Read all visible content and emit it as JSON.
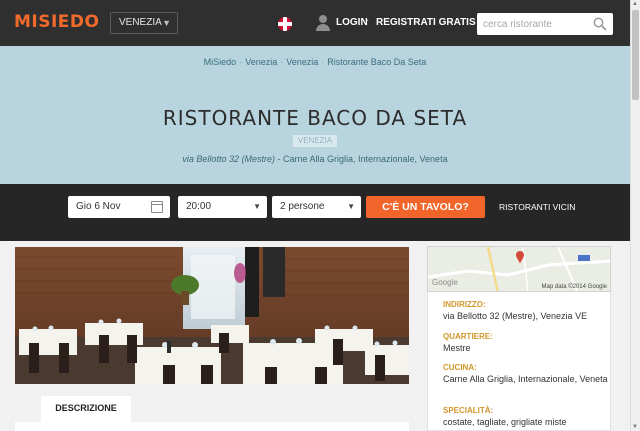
{
  "header": {
    "logo": "MISIEDO",
    "city_selector": "VENEZIA",
    "language_icon": "uk-flag-icon",
    "login": "LOGIN",
    "separator": "·",
    "register": "REGISTRATI GRATIS",
    "search_placeholder": "cerca ristorante"
  },
  "hero": {
    "breadcrumb": [
      "MiSiedo",
      "Venezia",
      "Venezia",
      "Ristorante Baco Da Seta"
    ],
    "breadcrumb_sep": "·",
    "title": "RISTORANTE BACO DA SETA",
    "city_badge": "VENEZIA",
    "address": "via Bellotto 32 (Mestre)",
    "cuisine_line": " - Carne Alla Griglia, Internazionale, Veneta",
    "background_color": "#b8d5df"
  },
  "booking": {
    "date": "Gio 6 Nov",
    "time": "20:00",
    "people": "2 persone",
    "cta": "C'È UN TAVOLO?",
    "nearby": "RISTORANTI VICIN",
    "cta_color": "#f2652a"
  },
  "map": {
    "logo": "Google",
    "credit": "Map data ©2014 Google"
  },
  "info": {
    "address_label": "INDIRIZZO:",
    "address_value": "via Bellotto 32 (Mestre), Venezia VE",
    "district_label": "QUARTIERE:",
    "district_value": "Mestre",
    "cuisine_label": "CUCINA:",
    "cuisine_value": "Carne Alla Griglia, Internazionale, Veneta",
    "specialty_label": "SPECIALITÀ:",
    "specialty_value": "costate, tagliate, grigliate miste",
    "label_color": "#d1962b"
  },
  "tabs": {
    "description": "DESCRIZIONE"
  }
}
